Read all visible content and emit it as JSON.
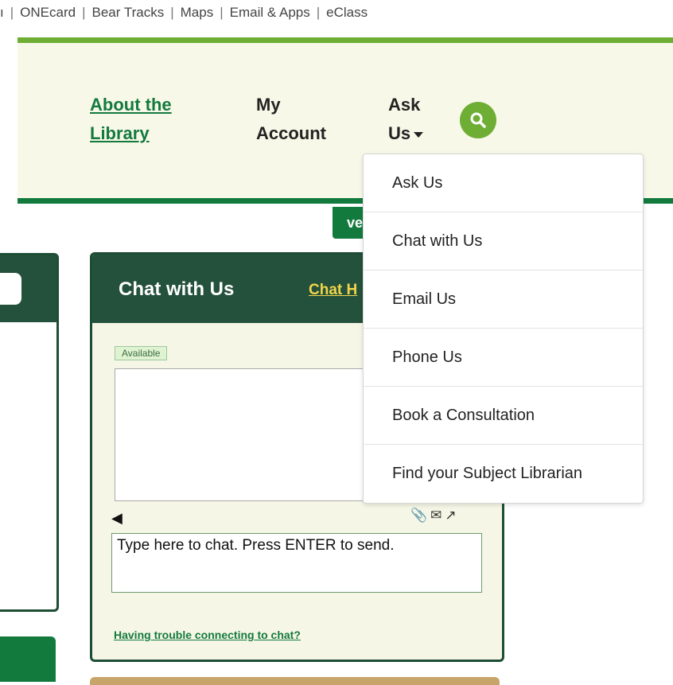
{
  "utility_nav": {
    "leading_fragment": "ı",
    "links": [
      "ONEcard",
      "Bear Tracks",
      "Maps",
      "Email & Apps",
      "eClass"
    ]
  },
  "main_nav": {
    "about_line1": "About the",
    "about_line2": "Library",
    "account_line1": "My",
    "account_line2": "Account",
    "ask_line1": "Ask",
    "ask_line2": "Us",
    "search_icon": "search-icon"
  },
  "tab_fragment": "ve",
  "chat": {
    "title": "Chat with Us",
    "help_link": "Chat H",
    "status_badge": "Available",
    "input_placeholder": "Type here to chat. Press ENTER to send.",
    "icons": [
      "speaker-icon",
      "paperclip-icon",
      "envelope-icon",
      "popout-icon"
    ],
    "trouble_link": "Having trouble connecting to chat?"
  },
  "ask_us_menu": {
    "items": [
      "Ask Us",
      "Chat with Us",
      "Email Us",
      "Phone Us",
      "Book a Consultation",
      "Find your Subject Librarian"
    ]
  },
  "colors": {
    "brand_green": "#137a3e",
    "light_green": "#6fae35",
    "dark_green": "#24513b",
    "header_bg": "#f8f8e8",
    "help_yellow": "#f2d54a"
  }
}
